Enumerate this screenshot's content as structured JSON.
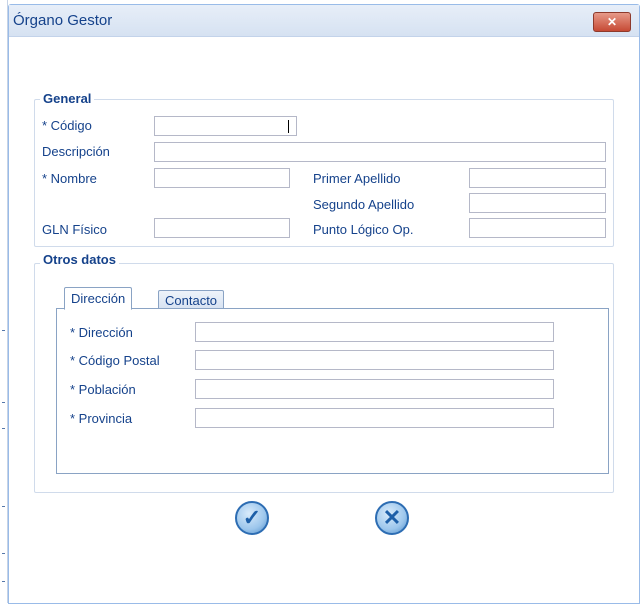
{
  "window": {
    "title": "Órgano Gestor",
    "close_glyph": "✕"
  },
  "general": {
    "legend": "General",
    "codigo_label": "* Código",
    "codigo_value": "",
    "descripcion_label": "Descripción",
    "descripcion_value": "",
    "nombre_label": "* Nombre",
    "nombre_value": "",
    "primer_apellido_label": "Primer Apellido",
    "primer_apellido_value": "",
    "segundo_apellido_label": "Segundo Apellido",
    "segundo_apellido_value": "",
    "gln_label": "GLN Físico",
    "gln_value": "",
    "punto_label": "Punto Lógico Op.",
    "punto_value": ""
  },
  "otros": {
    "legend": "Otros datos",
    "tabs": [
      {
        "label": "Dirección",
        "active": true
      },
      {
        "label": "Contacto",
        "active": false
      }
    ],
    "direccion_label": "* Dirección",
    "direccion_value": "",
    "cp_label": "* Código Postal",
    "cp_value": "",
    "poblacion_label": "* Población",
    "poblacion_value": "",
    "provincia_label": "* Provincia",
    "provincia_value": ""
  },
  "actions": {
    "accept_icon": "check-circle-icon",
    "accept_glyph": "✓",
    "cancel_icon": "x-circle-icon",
    "cancel_glyph": "✕"
  },
  "colors": {
    "label": "#15428b",
    "border": "#99bbe8",
    "close": "#c64a35"
  }
}
